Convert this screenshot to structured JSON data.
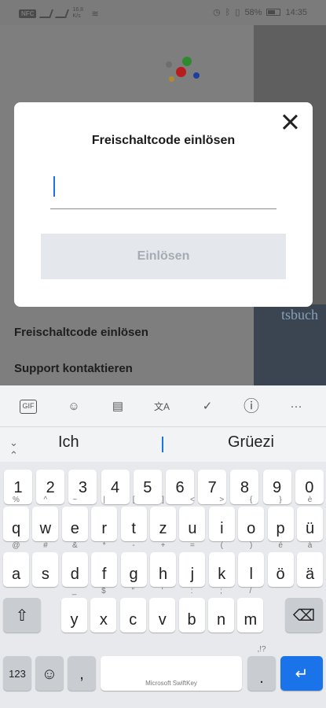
{
  "status_bar": {
    "nfc": "NFC",
    "network": "16.8 K/s",
    "battery": "58%",
    "time": "14:35"
  },
  "background_app": {
    "menu": [
      "Freischaltcode einlösen",
      "Support kontaktieren"
    ],
    "book_title": "tsbuch"
  },
  "dialog": {
    "title": "Freischaltcode einlösen",
    "input_value": "",
    "input_placeholder": "",
    "redeem_label": "Einlösen",
    "close_icon": "close-icon"
  },
  "keyboard": {
    "toolbar_icons": [
      "GIF",
      "☺",
      "▤",
      "文A",
      "✓",
      "ⓘ",
      "···"
    ],
    "suggestions": [
      "Ich",
      "Grüezi"
    ],
    "row_numbers": [
      "1",
      "2",
      "3",
      "4",
      "5",
      "6",
      "7",
      "8",
      "9",
      "0"
    ],
    "row1": [
      [
        "q",
        "%"
      ],
      [
        "w",
        "^"
      ],
      [
        "e",
        "~"
      ],
      [
        "r",
        "|"
      ],
      [
        "t",
        "["
      ],
      [
        "z",
        "]"
      ],
      [
        "u",
        "<"
      ],
      [
        "i",
        ">"
      ],
      [
        "o",
        "{"
      ],
      [
        "p",
        "}"
      ],
      [
        "ü",
        "è"
      ]
    ],
    "row2": [
      [
        "a",
        "@"
      ],
      [
        "s",
        "#"
      ],
      [
        "d",
        "&"
      ],
      [
        "f",
        "*"
      ],
      [
        "g",
        "-"
      ],
      [
        "h",
        "+"
      ],
      [
        "j",
        "="
      ],
      [
        "k",
        "("
      ],
      [
        "l",
        ")"
      ],
      [
        "ö",
        "é"
      ],
      [
        "ä",
        "à"
      ]
    ],
    "row3": [
      [
        "y",
        "_"
      ],
      [
        "x",
        "$"
      ],
      [
        "c",
        "\""
      ],
      [
        "v",
        "'"
      ],
      [
        "b",
        ":"
      ],
      [
        "n",
        ";"
      ],
      [
        "m",
        "/"
      ]
    ],
    "bottom": {
      "numbers": "123",
      "emoji": "☺",
      "comma": ",",
      "space_label": "Microsoft SwiftKey",
      "period": ".",
      "period_alt": ",!?"
    },
    "shift_icon": "shift-icon",
    "backspace_icon": "backspace-icon",
    "enter_icon": "enter-icon"
  }
}
